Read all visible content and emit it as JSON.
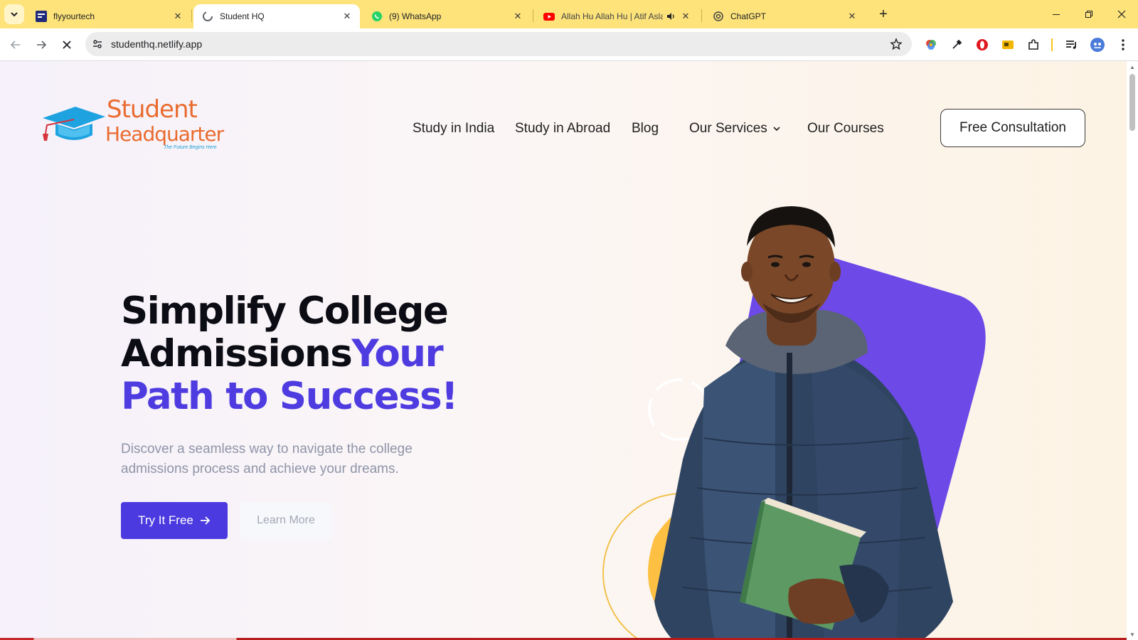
{
  "browser": {
    "tabs": [
      {
        "title": "flyyourtech",
        "icon": "flyyourtech-favicon",
        "active": false
      },
      {
        "title": "Student HQ",
        "icon": "loading-spinner-icon",
        "active": true
      },
      {
        "title": "(9) WhatsApp",
        "icon": "whatsapp-icon",
        "active": false
      },
      {
        "title": "Allah Hu Allah Hu | Atif Asla",
        "icon": "youtube-icon",
        "active": false,
        "audio": true
      },
      {
        "title": "ChatGPT",
        "icon": "chatgpt-icon",
        "active": false
      }
    ],
    "url": "studenthq.netlify.app",
    "tabstrip_color": "#fde37a"
  },
  "site": {
    "logo": {
      "line1": "Student",
      "line2": "Headquarter",
      "tagline": "The Future Begins Here"
    },
    "nav": [
      {
        "label": "Study in India"
      },
      {
        "label": "Study in Abroad"
      },
      {
        "label": "Blog"
      },
      {
        "label": "Our Services",
        "has_dropdown": true
      },
      {
        "label": "Our Courses"
      }
    ],
    "cta": "Free Consultation"
  },
  "hero": {
    "title_part1": "Simplify College Admissions",
    "title_part2": "Your Path to Success!",
    "subtitle": "Discover a seamless way to navigate the college admissions process and achieve your dreams.",
    "primary_button": "Try It Free",
    "secondary_button": "Learn More",
    "accent_color": "#4f3ce0"
  }
}
